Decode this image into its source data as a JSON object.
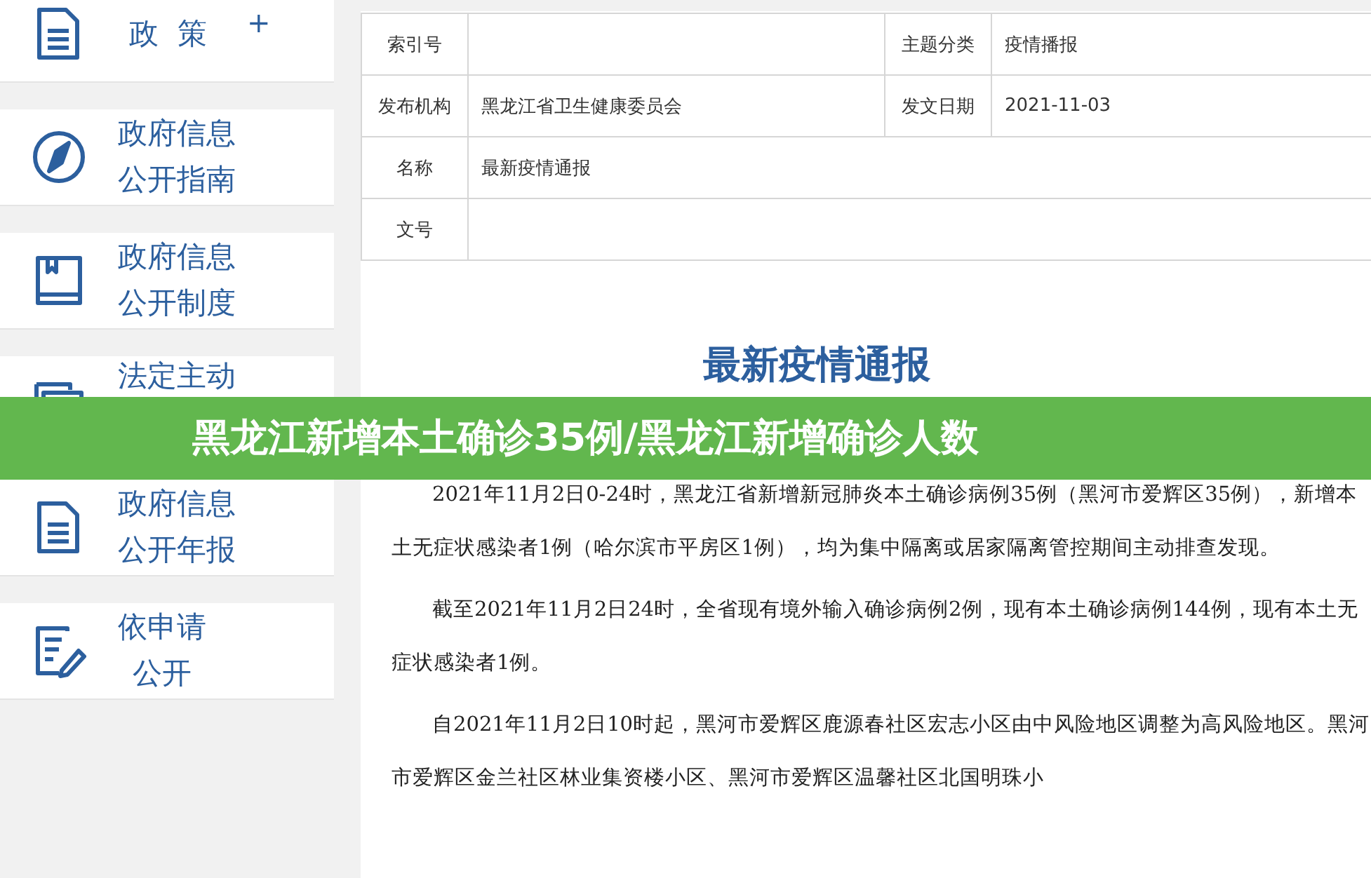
{
  "sidebar": {
    "items": [
      {
        "lines": [
          "政  策"
        ],
        "expander": "+"
      },
      {
        "lines": [
          "政府信息",
          "公开指南"
        ]
      },
      {
        "lines": [
          "政府信息",
          "公开制度"
        ]
      },
      {
        "lines": [
          "法定主动"
        ]
      },
      {
        "lines": [
          "政府信息",
          "公开年报"
        ]
      },
      {
        "lines": [
          "依申请",
          "公开"
        ]
      }
    ]
  },
  "info_table": {
    "rows": [
      {
        "label": "索引号",
        "label_2": "主题分类",
        "value_2": "疫情播报"
      },
      {
        "label": "发布机构",
        "value": "黑龙江省卫生健康委员会",
        "label_2": "发文日期",
        "value_2": "2021-11-03"
      },
      {
        "label": "名称",
        "value": "最新疫情通报"
      },
      {
        "label": "文号"
      }
    ]
  },
  "article": {
    "title": "最新疫情通报",
    "paragraphs": [
      "2021年11月2日0-24时，黑龙江省新增新冠肺炎本土确诊病例35例（黑河市爱辉区35例），新增本土无症状感染者1例（哈尔滨市平房区1例），均为集中隔离或居家隔离管控期间主动排查发现。",
      "截至2021年11月2日24时，全省现有境外输入确诊病例2例，现有本土确诊病例144例，现有本土无症状感染者1例。",
      "自2021年11月2日10时起，黑河市爱辉区鹿源春社区宏志小区由中风险地区调整为高风险地区。黑河市爱辉区金兰社区林业集资楼小区、黑河市爱辉区温馨社区北国明珠小"
    ]
  },
  "banner": {
    "text": "黑龙江新增本土确诊35例/黑龙江新增确诊人数"
  }
}
